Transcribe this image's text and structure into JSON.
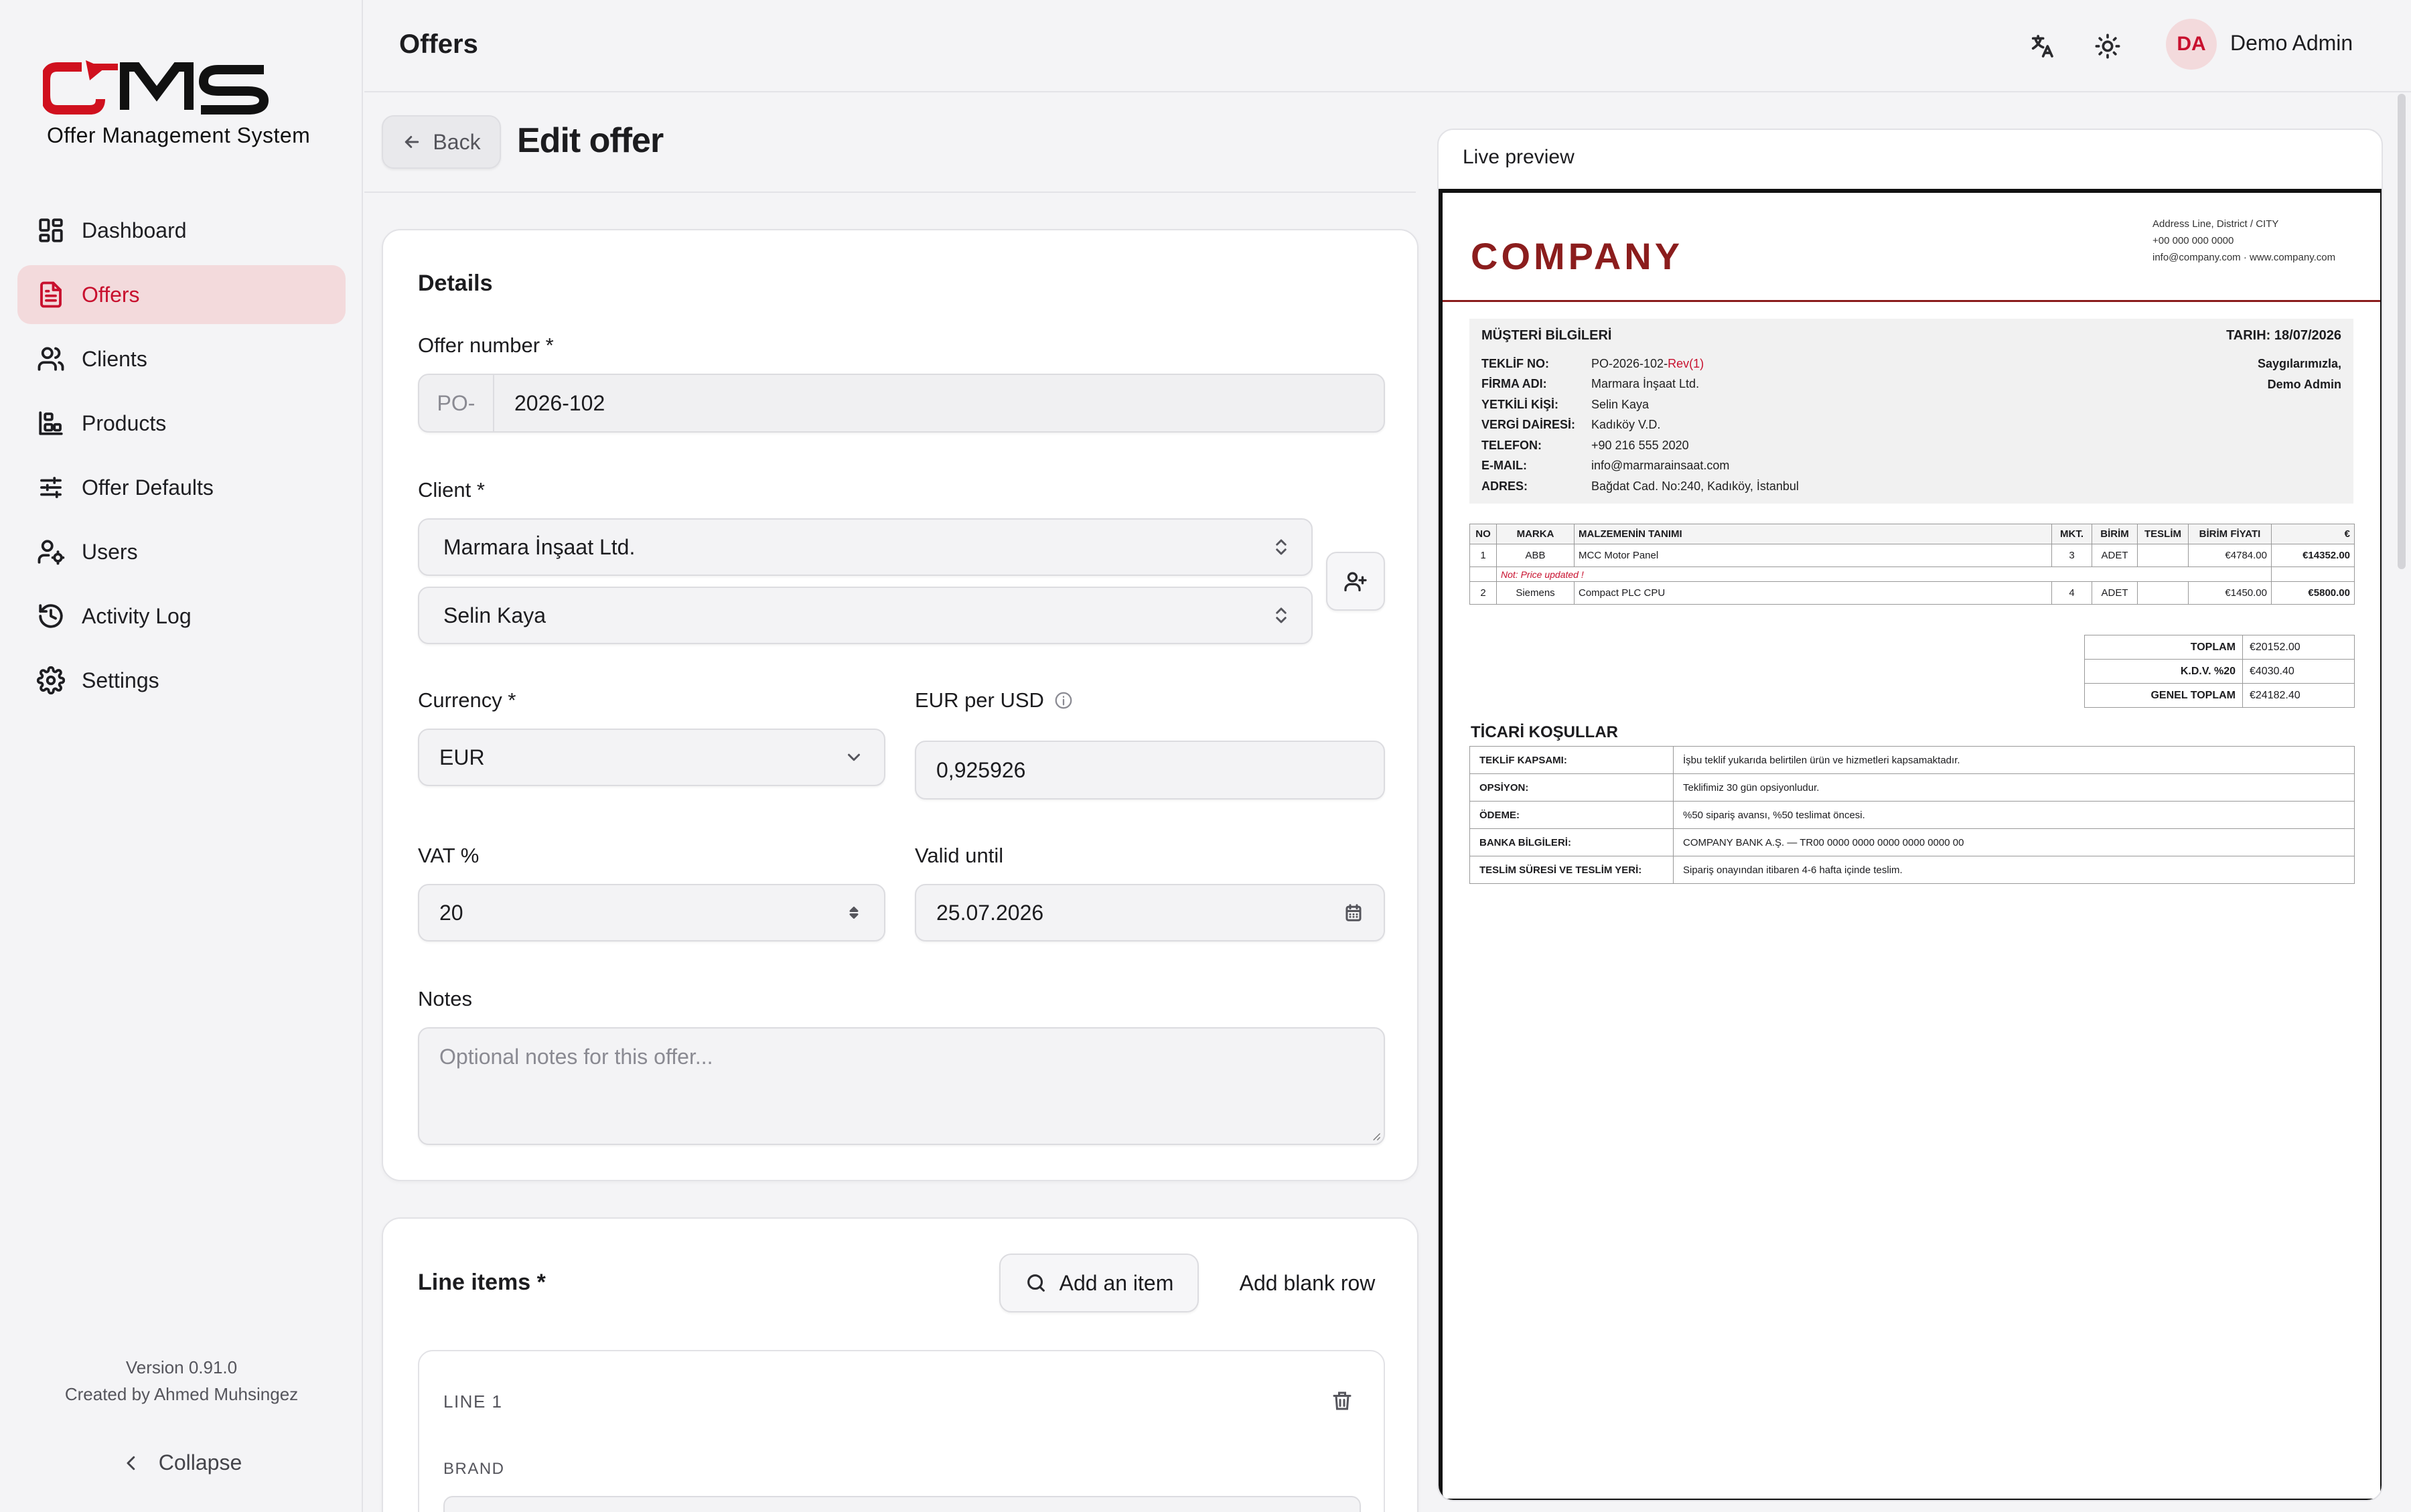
{
  "app": {
    "logo_text": "OMS",
    "logo_subtitle": "Offer Management System",
    "version": "Version 0.91.0",
    "credit": "Created by Ahmed Muhsingez",
    "collapse_label": "Collapse",
    "accent_color": "#c8102e"
  },
  "sidebar": {
    "items": [
      {
        "label": "Dashboard",
        "icon": "dashboard-icon",
        "active": false
      },
      {
        "label": "Offers",
        "icon": "document-icon",
        "active": true
      },
      {
        "label": "Clients",
        "icon": "users-icon",
        "active": false
      },
      {
        "label": "Products",
        "icon": "products-icon",
        "active": false
      },
      {
        "label": "Offer Defaults",
        "icon": "sliders-icon",
        "active": false
      },
      {
        "label": "Users",
        "icon": "user-cog-icon",
        "active": false
      },
      {
        "label": "Activity Log",
        "icon": "history-icon",
        "active": false
      },
      {
        "label": "Settings",
        "icon": "gear-icon",
        "active": false
      }
    ]
  },
  "topbar": {
    "title": "Offers",
    "avatar_initials": "DA",
    "user_name": "Demo Admin"
  },
  "subheader": {
    "back_label": "Back",
    "title": "Edit offer"
  },
  "details": {
    "title": "Details",
    "offer_number_label": "Offer number *",
    "offer_prefix": "PO-",
    "offer_number": "2026-102",
    "client_label": "Client *",
    "client_value": "Marmara İnşaat Ltd.",
    "contact_value": "Selin Kaya",
    "currency_label": "Currency *",
    "currency_value": "EUR",
    "rate_label": "EUR per USD",
    "rate_value": "0,925926",
    "vat_label": "VAT %",
    "vat_value": "20",
    "valid_label": "Valid until",
    "valid_value": "25.07.2026",
    "notes_label": "Notes",
    "notes_placeholder": "Optional notes for this offer..."
  },
  "line_items": {
    "title": "Line items *",
    "add_item_label": "Add an item",
    "add_blank_label": "Add blank row",
    "line_label": "LINE 1",
    "brand_label": "BRAND"
  },
  "preview": {
    "title": "Live preview",
    "company": "COMPANY",
    "address_lines": [
      "Address Line, District / CITY",
      "+00 000 000 0000",
      "info@company.com · www.company.com"
    ],
    "customer_header": "MÜŞTERİ BİLGİLERİ",
    "date": "TARIH: 18/07/2026",
    "customer_rows": [
      {
        "k": "TEKLİF NO:",
        "v": "PO-2026-102-",
        "rev": "Rev(1)"
      },
      {
        "k": "FİRMA ADI:",
        "v": "Marmara İnşaat Ltd."
      },
      {
        "k": "YETKİLİ KİŞİ:",
        "v": "Selin Kaya"
      },
      {
        "k": "VERGİ DAİRESİ:",
        "v": "Kadıköy V.D."
      },
      {
        "k": "TELEFON:",
        "v": "+90 216 555 2020"
      },
      {
        "k": "E-MAIL:",
        "v": "info@marmarainsaat.com"
      },
      {
        "k": "ADRES:",
        "v": "Bağdat Cad. No:240, Kadıköy, İstanbul"
      }
    ],
    "signature_1": "Saygılarımızla,",
    "signature_2": "Demo Admin",
    "item_headers": [
      "NO",
      "MARKA",
      "MALZEMENİN TANIMI",
      "MKT.",
      "BİRİM",
      "TESLİM",
      "BİRİM FİYATI",
      "€"
    ],
    "items": [
      {
        "no": "1",
        "brand": "ABB",
        "desc": "MCC Motor Panel",
        "qty": "3",
        "unit": "ADET",
        "delivery": "",
        "price": "€4784.00",
        "total": "€14352.00",
        "note": "Not: Price updated !"
      },
      {
        "no": "2",
        "brand": "Siemens",
        "desc": "Compact PLC CPU",
        "qty": "4",
        "unit": "ADET",
        "delivery": "",
        "price": "€1450.00",
        "total": "€5800.00",
        "note": ""
      }
    ],
    "totals": [
      {
        "k": "TOPLAM",
        "v": "€20152.00"
      },
      {
        "k": "K.D.V. %20",
        "v": "€4030.40"
      },
      {
        "k": "GENEL TOPLAM",
        "v": "€24182.40"
      }
    ],
    "terms_title": "TİCARİ KOŞULLAR",
    "terms": [
      {
        "k": "TEKLİF KAPSAMI:",
        "v": "İşbu teklif yukarıda belirtilen ürün ve hizmetleri kapsamaktadır."
      },
      {
        "k": "OPSİYON:",
        "v": "Teklifimiz 30 gün opsiyonludur."
      },
      {
        "k": "ÖDEME:",
        "v": "%50 sipariş avansı, %50 teslimat öncesi."
      },
      {
        "k": "BANKA BİLGİLERİ:",
        "v": "COMPANY BANK A.Ş. — TR00 0000 0000 0000 0000 0000 00"
      },
      {
        "k": "TESLİM SÜRESİ VE TESLİM YERİ:",
        "v": "Sipariş onayından itibaren 4-6 hafta içinde teslim."
      }
    ]
  }
}
